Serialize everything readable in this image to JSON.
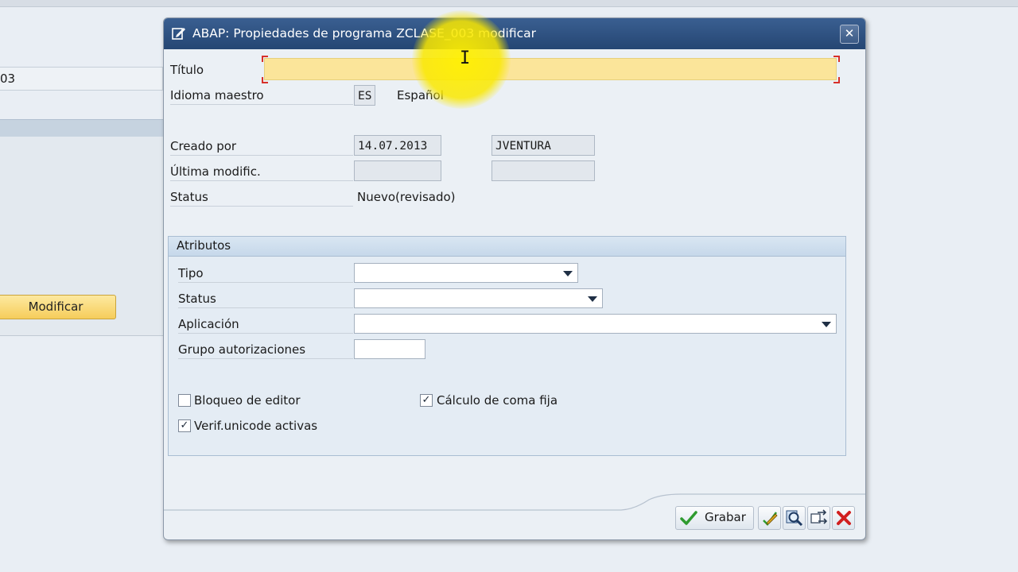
{
  "background": {
    "field_value": "03",
    "modify_button": "Modificar"
  },
  "dialog": {
    "title": "ABAP: Propiedades de programa ZCLASE_003 modificar",
    "close_icon": "close-icon",
    "fields": {
      "titulo_label": "Título",
      "titulo_value": "",
      "idioma_label": "Idioma maestro",
      "idioma_code": "ES",
      "idioma_name": "Español",
      "creado_label": "Creado por",
      "creado_date": "14.07.2013",
      "creado_user": "JVENTURA",
      "ultima_label": "Última modific.",
      "ultima_date": "",
      "ultima_user": "",
      "status_label": "Status",
      "status_value": "Nuevo(revisado)"
    },
    "attributes": {
      "heading": "Atributos",
      "tipo_label": "Tipo",
      "tipo_value": "",
      "status_label": "Status",
      "status_value": "",
      "aplicacion_label": "Aplicación",
      "aplicacion_value": "",
      "grupo_label": "Grupo autorizaciones",
      "grupo_value": "",
      "checkboxes": [
        {
          "label": "Bloqueo de editor",
          "checked": false
        },
        {
          "label": "Cálculo de coma fija",
          "checked": true
        },
        {
          "label": "Verif.unicode activas",
          "checked": true
        }
      ]
    },
    "footer": {
      "save_label": "Grabar",
      "icons": [
        "check-icon",
        "edit-icon",
        "search-icon",
        "transfer-icon",
        "cancel-icon"
      ]
    }
  },
  "colors": {
    "titlebar": "#2c4f7f",
    "required_field": "#fbe59a",
    "background": "#e9eef4"
  }
}
